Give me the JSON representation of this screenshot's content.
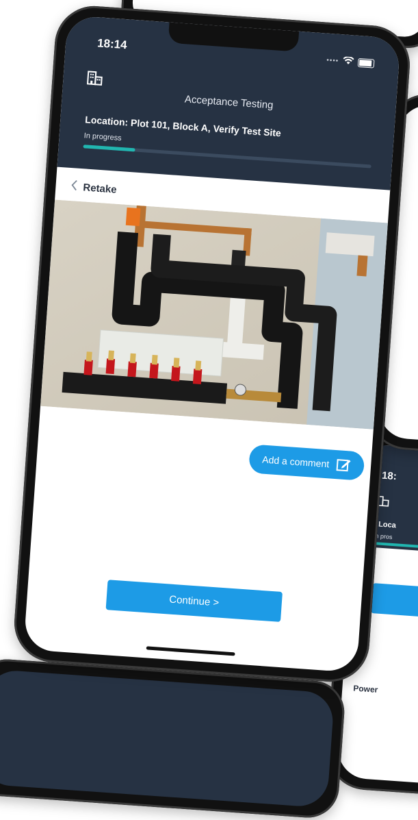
{
  "status": {
    "time": "18:14",
    "signal_dots": "••••"
  },
  "header": {
    "app_title": "Acceptance Testing",
    "location_label": "Location:",
    "location_value": "Plot 101, Block A, Verify Test Site",
    "progress_label": "In progress",
    "progress_fraction": 0.18
  },
  "nav": {
    "back_label": "Retake"
  },
  "actions": {
    "comment_label": "Add a comment",
    "continue_label": "Continue >"
  },
  "side_phone": {
    "time": "18:",
    "location_partial": "Loca",
    "progress_partial": "In pros",
    "row_partial": "Power"
  },
  "colors": {
    "header_bg": "#263243",
    "accent_blue": "#1d9be6",
    "progress_teal": "#21b6b0"
  },
  "icons": {
    "building": "building-icon",
    "edit": "edit-icon",
    "back": "chevron-left-icon",
    "wifi": "wifi-icon",
    "battery": "battery-icon"
  }
}
